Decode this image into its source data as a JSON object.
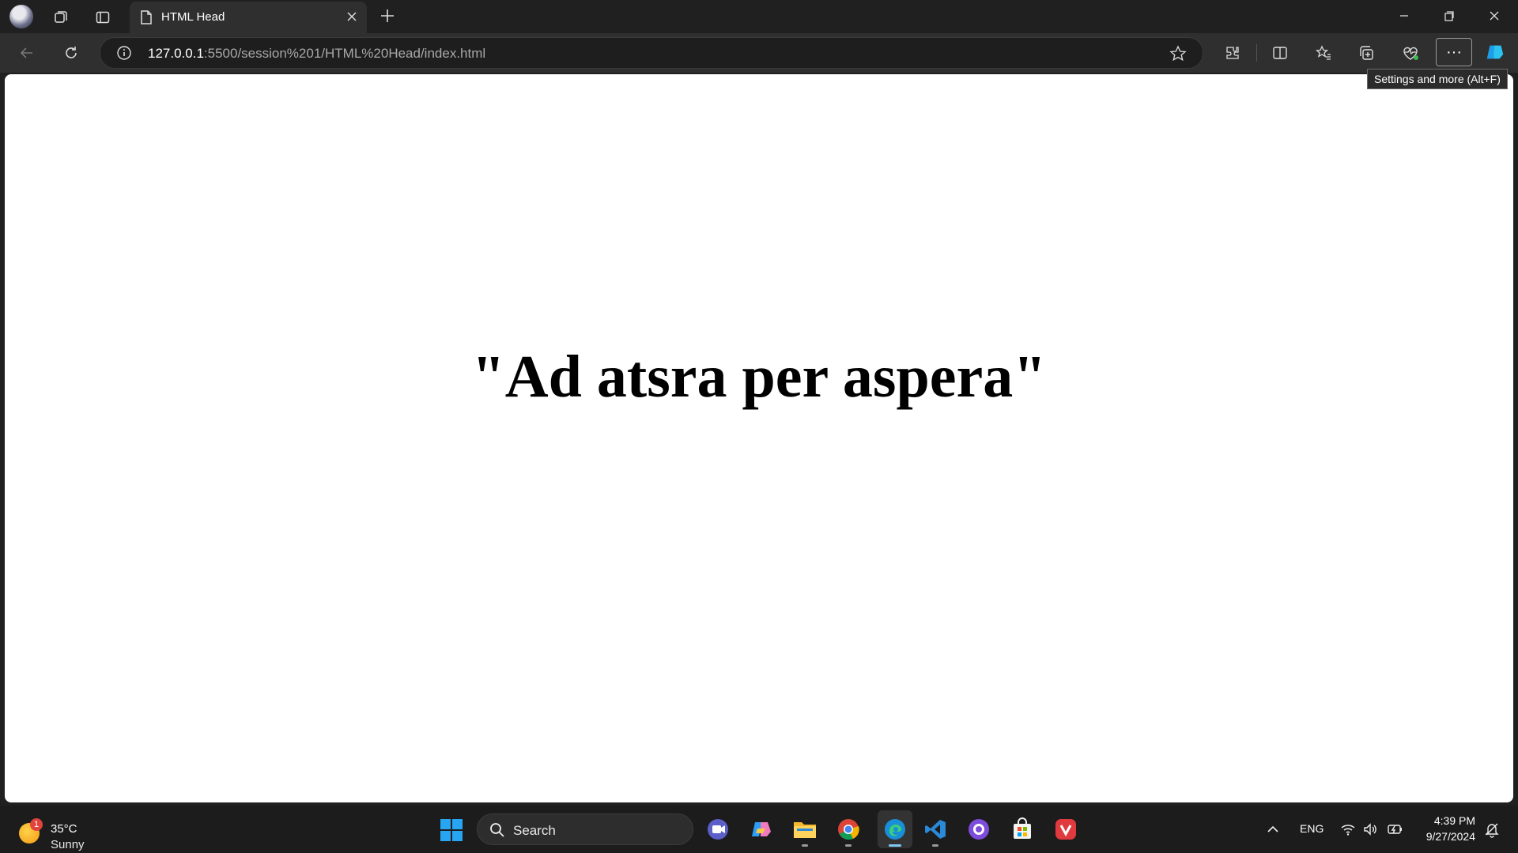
{
  "browser": {
    "tab": {
      "title": "HTML Head"
    },
    "address": {
      "host": "127.0.0.1",
      "rest": ":5500/session%201/HTML%20Head/index.html"
    },
    "tooltip": "Settings and more (Alt+F)",
    "more_label": "···"
  },
  "page": {
    "headline": "\"Ad atsra per aspera\""
  },
  "taskbar": {
    "weather": {
      "badge": "1",
      "temp": "35°C",
      "condition": "Sunny"
    },
    "search_label": "Search",
    "language": "ENG",
    "time": "4:39 PM",
    "date": "9/27/2024"
  },
  "colors": {
    "accent": "#0078d4",
    "titlebar": "#202020",
    "toolbar": "#2f2f2f"
  }
}
